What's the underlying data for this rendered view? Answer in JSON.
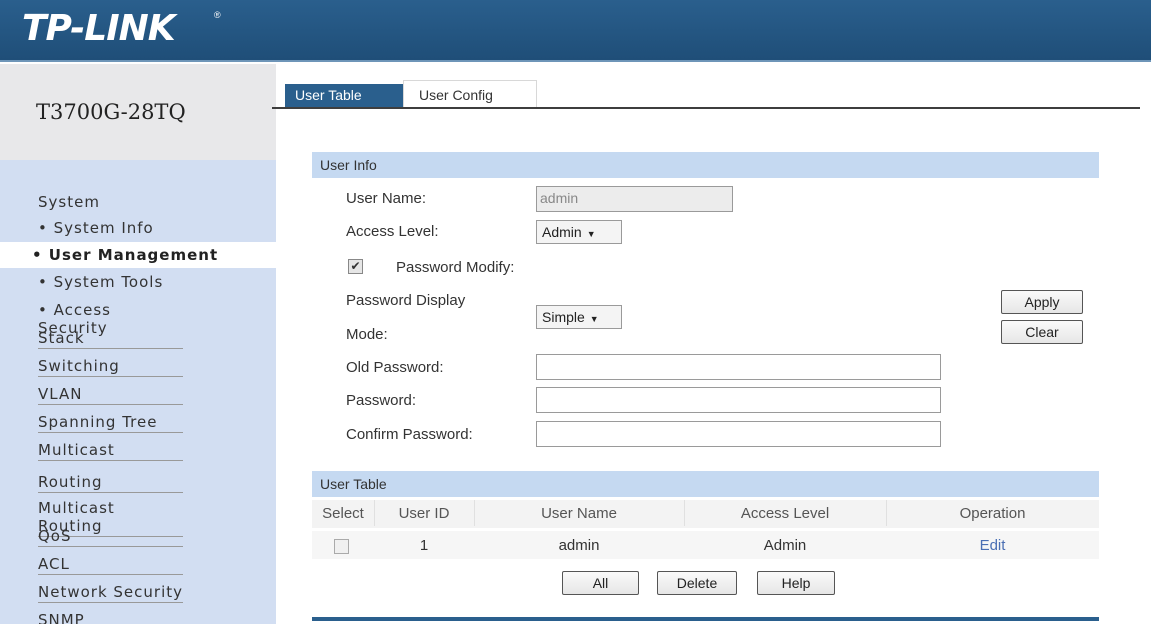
{
  "brand": {
    "logo": "TP-LINK",
    "logo_mark": "®"
  },
  "device": {
    "model": "T3700G-28TQ"
  },
  "tabs": [
    {
      "label": "User Table"
    },
    {
      "label": "User Config"
    }
  ],
  "sidebar": {
    "section_system": "System",
    "sub_items": [
      "• System Info",
      "• User Management",
      "• System Tools",
      "• Access Security"
    ],
    "categories": [
      "Stack",
      "Switching",
      "VLAN",
      "Spanning Tree",
      "Multicast",
      "Routing",
      "Multicast Routing",
      "QoS",
      "ACL",
      "Network Security",
      "SNMP"
    ]
  },
  "user_info": {
    "title": "User Info",
    "user_name_label": "User Name:",
    "user_name_value": "admin",
    "access_level_label": "Access Level:",
    "access_level_value": "Admin",
    "password_modify_label": "Password Modify:",
    "password_modify_checked": true,
    "password_display_label_line1": "Password Display",
    "password_display_label_line2": "Mode:",
    "password_display_value": "Simple",
    "old_password_label": "Old Password:",
    "password_label": "Password:",
    "confirm_password_label": "Confirm Password:",
    "apply_label": "Apply",
    "clear_label": "Clear"
  },
  "user_table": {
    "title": "User Table",
    "columns": [
      "Select",
      "User ID",
      "User Name",
      "Access Level",
      "Operation"
    ],
    "rows": [
      {
        "id": "1",
        "name": "admin",
        "level": "Admin",
        "operation": "Edit"
      }
    ],
    "buttons": {
      "all": "All",
      "delete": "Delete",
      "help": "Help"
    }
  },
  "colors": {
    "header_blue": "#2a5f8d",
    "sidebar_blue": "#d2def2",
    "panel_head": "#c5d9f1",
    "link_blue": "#4a6fb3"
  }
}
